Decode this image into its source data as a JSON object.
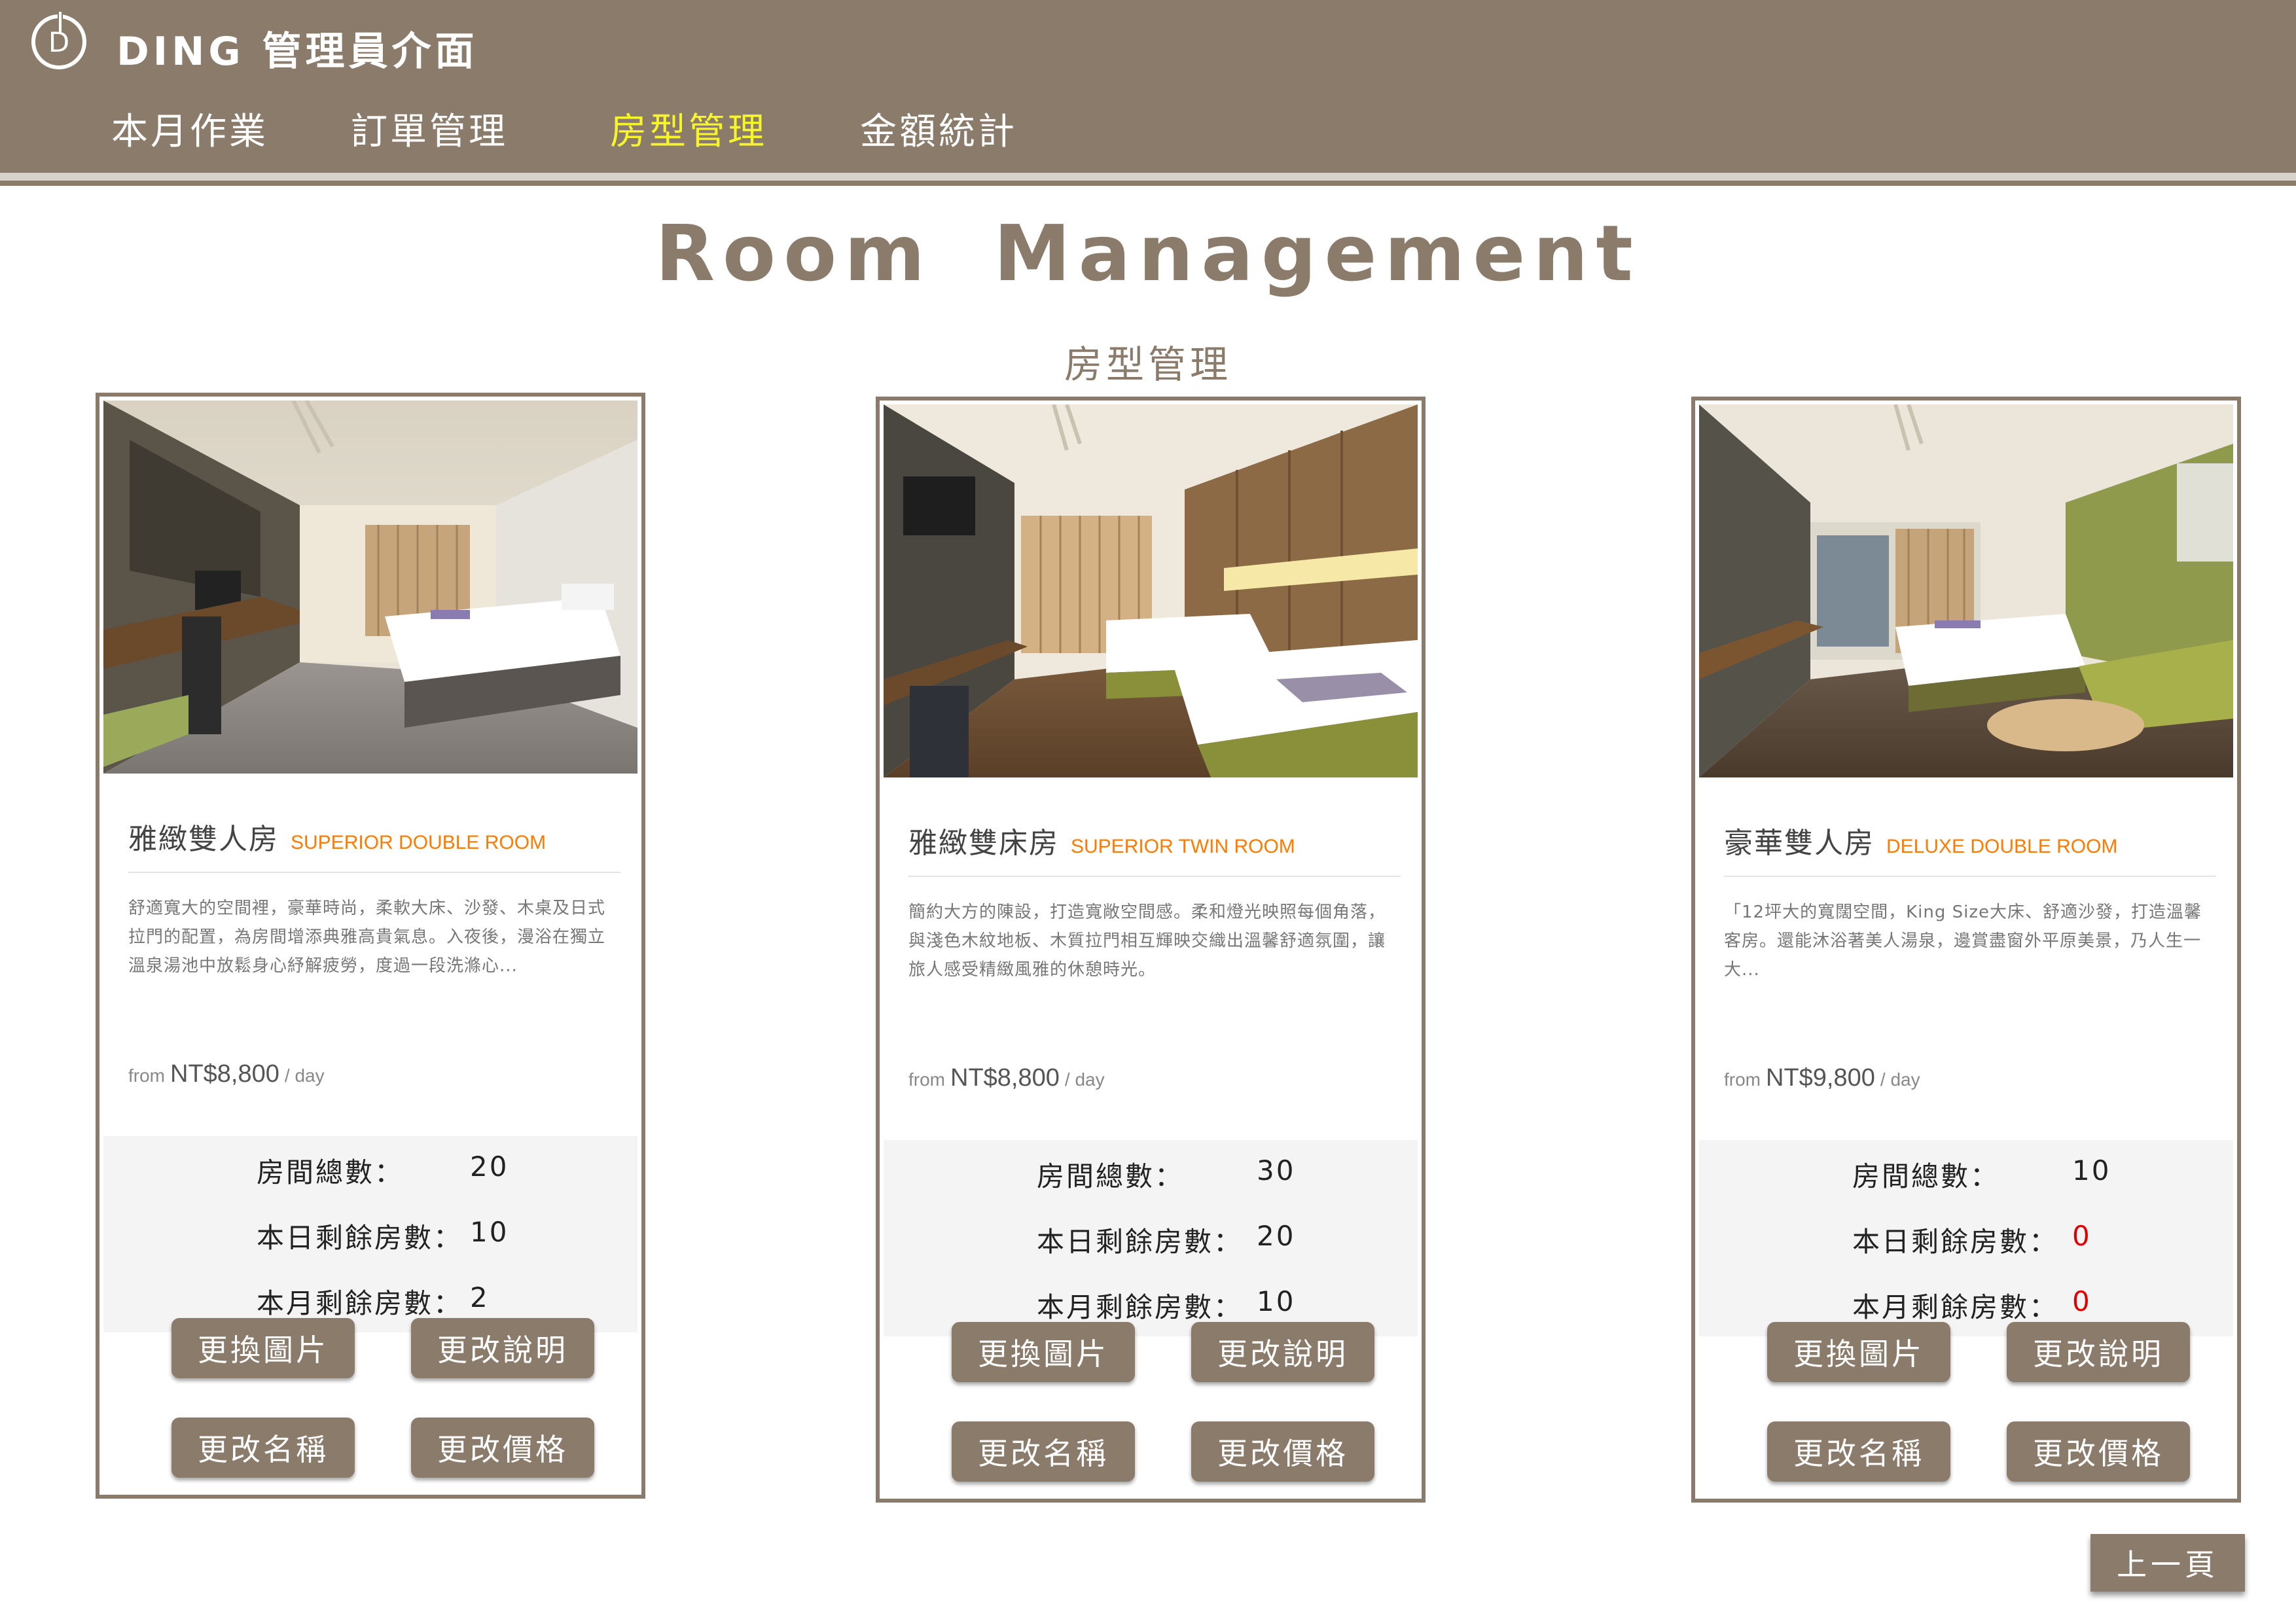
{
  "header": {
    "logo_letter": "D",
    "app_title": "DING 管理員介面",
    "nav": [
      {
        "label": "本月作業",
        "active": false
      },
      {
        "label": "訂單管理",
        "active": false
      },
      {
        "label": "房型管理",
        "active": true
      },
      {
        "label": "金額統計",
        "active": false
      }
    ],
    "active_color": "#f5f52a",
    "bar_color": "#8b7b6b"
  },
  "main": {
    "title": "Room  Management",
    "subtitle": "房型管理"
  },
  "rooms": [
    {
      "name_zh": "雅緻雙人房",
      "name_en": "SUPERIOR DOUBLE ROOM",
      "description": "舒適寬大的空間裡，豪華時尚，柔軟大床、沙發、木桌及日式拉門的配置，為房間增添典雅高貴氣息。入夜後，漫浴在獨立溫泉湯池中放鬆身心紓解疲勞，度過一段洗滌心...",
      "price_from": "from",
      "price": "NT$8,800",
      "price_unit": "/ day",
      "total_label": "房間總數：",
      "total": "20",
      "today_label": "本日剩餘房數：",
      "today": "10",
      "month_label": "本月剩餘房數：",
      "month": "2",
      "photo": "room-photo-double"
    },
    {
      "name_zh": "雅緻雙床房",
      "name_en": "SUPERIOR TWIN ROOM",
      "description": "簡約大方的陳設，打造寬敞空間感。柔和燈光映照每個角落，與淺色木紋地板、木質拉門相互輝映交織出溫馨舒適氛圍，讓旅人感受精緻風雅的休憩時光。",
      "price_from": "from",
      "price": "NT$8,800",
      "price_unit": "/ day",
      "total_label": "房間總數：",
      "total": "30",
      "today_label": "本日剩餘房數：",
      "today": "20",
      "month_label": "本月剩餘房數：",
      "month": "10",
      "photo": "room-photo-twin"
    },
    {
      "name_zh": "豪華雙人房",
      "name_en": "DELUXE DOUBLE ROOM",
      "description": "「12坪大的寬闊空間，King Size大床、舒適沙發，打造溫馨客房。還能沐浴著美人湯泉，邊賞盡窗外平原美景，乃人生一大...",
      "price_from": "from",
      "price": "NT$9,800",
      "price_unit": "/ day",
      "total_label": "房間總數：",
      "total": "10",
      "today_label": "本日剩餘房數：",
      "today": "0",
      "month_label": "本月剩餘房數：",
      "month": "0",
      "photo": "room-photo-deluxe"
    }
  ],
  "buttons": {
    "change_image": "更換圖片",
    "change_description": "更改說明",
    "change_name": "更改名稱",
    "change_price": "更改價格"
  },
  "back_button": "上一頁",
  "colors": {
    "brand": "#8b7b6b",
    "accent_en": "#ff7b00",
    "zero_alert": "#e00000"
  }
}
